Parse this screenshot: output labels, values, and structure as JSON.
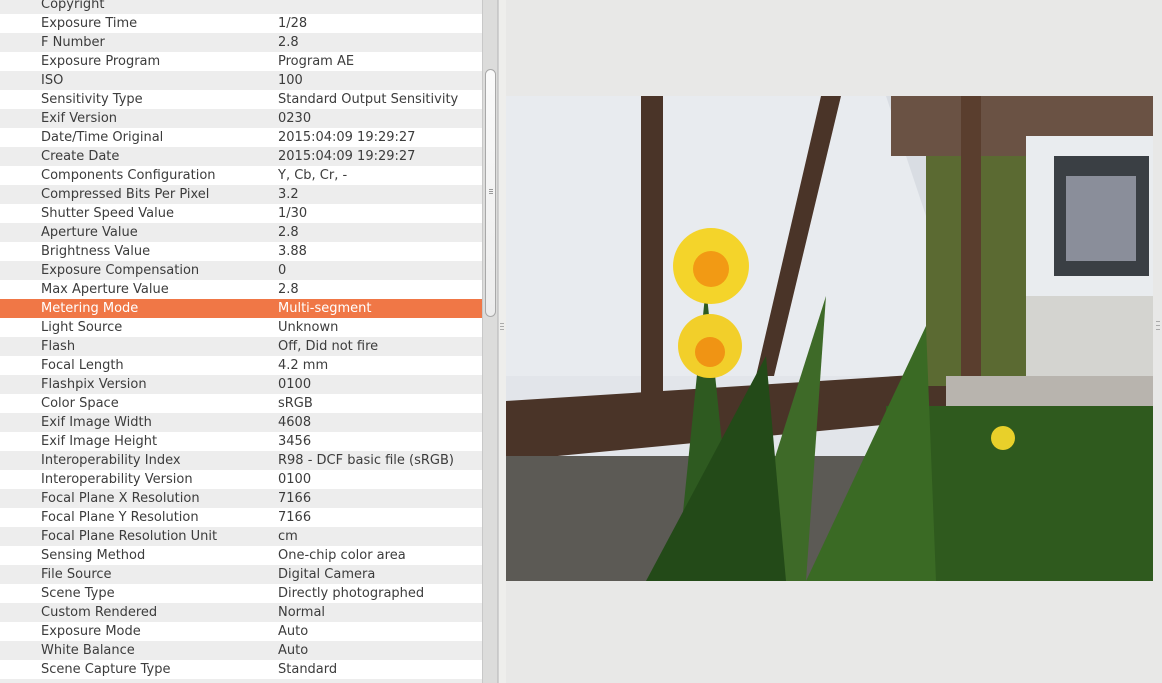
{
  "exif_table": {
    "selected": "Metering Mode",
    "rows": [
      {
        "key": "Copyright",
        "value": ""
      },
      {
        "key": "Exposure Time",
        "value": "1/28"
      },
      {
        "key": "F Number",
        "value": "2.8"
      },
      {
        "key": "Exposure Program",
        "value": "Program AE"
      },
      {
        "key": "ISO",
        "value": "100"
      },
      {
        "key": "Sensitivity Type",
        "value": "Standard Output Sensitivity"
      },
      {
        "key": "Exif Version",
        "value": "0230"
      },
      {
        "key": "Date/Time Original",
        "value": "2015:04:09 19:29:27"
      },
      {
        "key": "Create Date",
        "value": "2015:04:09 19:29:27"
      },
      {
        "key": "Components Configuration",
        "value": "Y, Cb, Cr, -"
      },
      {
        "key": "Compressed Bits Per Pixel",
        "value": "3.2"
      },
      {
        "key": "Shutter Speed Value",
        "value": "1/30"
      },
      {
        "key": "Aperture Value",
        "value": "2.8"
      },
      {
        "key": "Brightness Value",
        "value": "3.88"
      },
      {
        "key": "Exposure Compensation",
        "value": "0"
      },
      {
        "key": "Max Aperture Value",
        "value": "2.8"
      },
      {
        "key": "Metering Mode",
        "value": "Multi-segment"
      },
      {
        "key": "Light Source",
        "value": "Unknown"
      },
      {
        "key": "Flash",
        "value": "Off, Did not fire"
      },
      {
        "key": "Focal Length",
        "value": "4.2 mm"
      },
      {
        "key": "Flashpix Version",
        "value": "0100"
      },
      {
        "key": "Color Space",
        "value": "sRGB"
      },
      {
        "key": "Exif Image Width",
        "value": "4608"
      },
      {
        "key": "Exif Image Height",
        "value": "3456"
      },
      {
        "key": "Interoperability Index",
        "value": "R98 - DCF basic file (sRGB)"
      },
      {
        "key": "Interoperability Version",
        "value": "0100"
      },
      {
        "key": "Focal Plane X Resolution",
        "value": "7166"
      },
      {
        "key": "Focal Plane Y Resolution",
        "value": "7166"
      },
      {
        "key": "Focal Plane Resolution Unit",
        "value": "cm"
      },
      {
        "key": "Sensing Method",
        "value": "One-chip color area"
      },
      {
        "key": "File Source",
        "value": "Digital Camera"
      },
      {
        "key": "Scene Type",
        "value": "Directly photographed"
      },
      {
        "key": "Custom Rendered",
        "value": "Normal"
      },
      {
        "key": "Exposure Mode",
        "value": "Auto"
      },
      {
        "key": "White Balance",
        "value": "Auto"
      },
      {
        "key": "Scene Capture Type",
        "value": "Standard"
      }
    ]
  },
  "colors": {
    "selection": "#f07746"
  }
}
